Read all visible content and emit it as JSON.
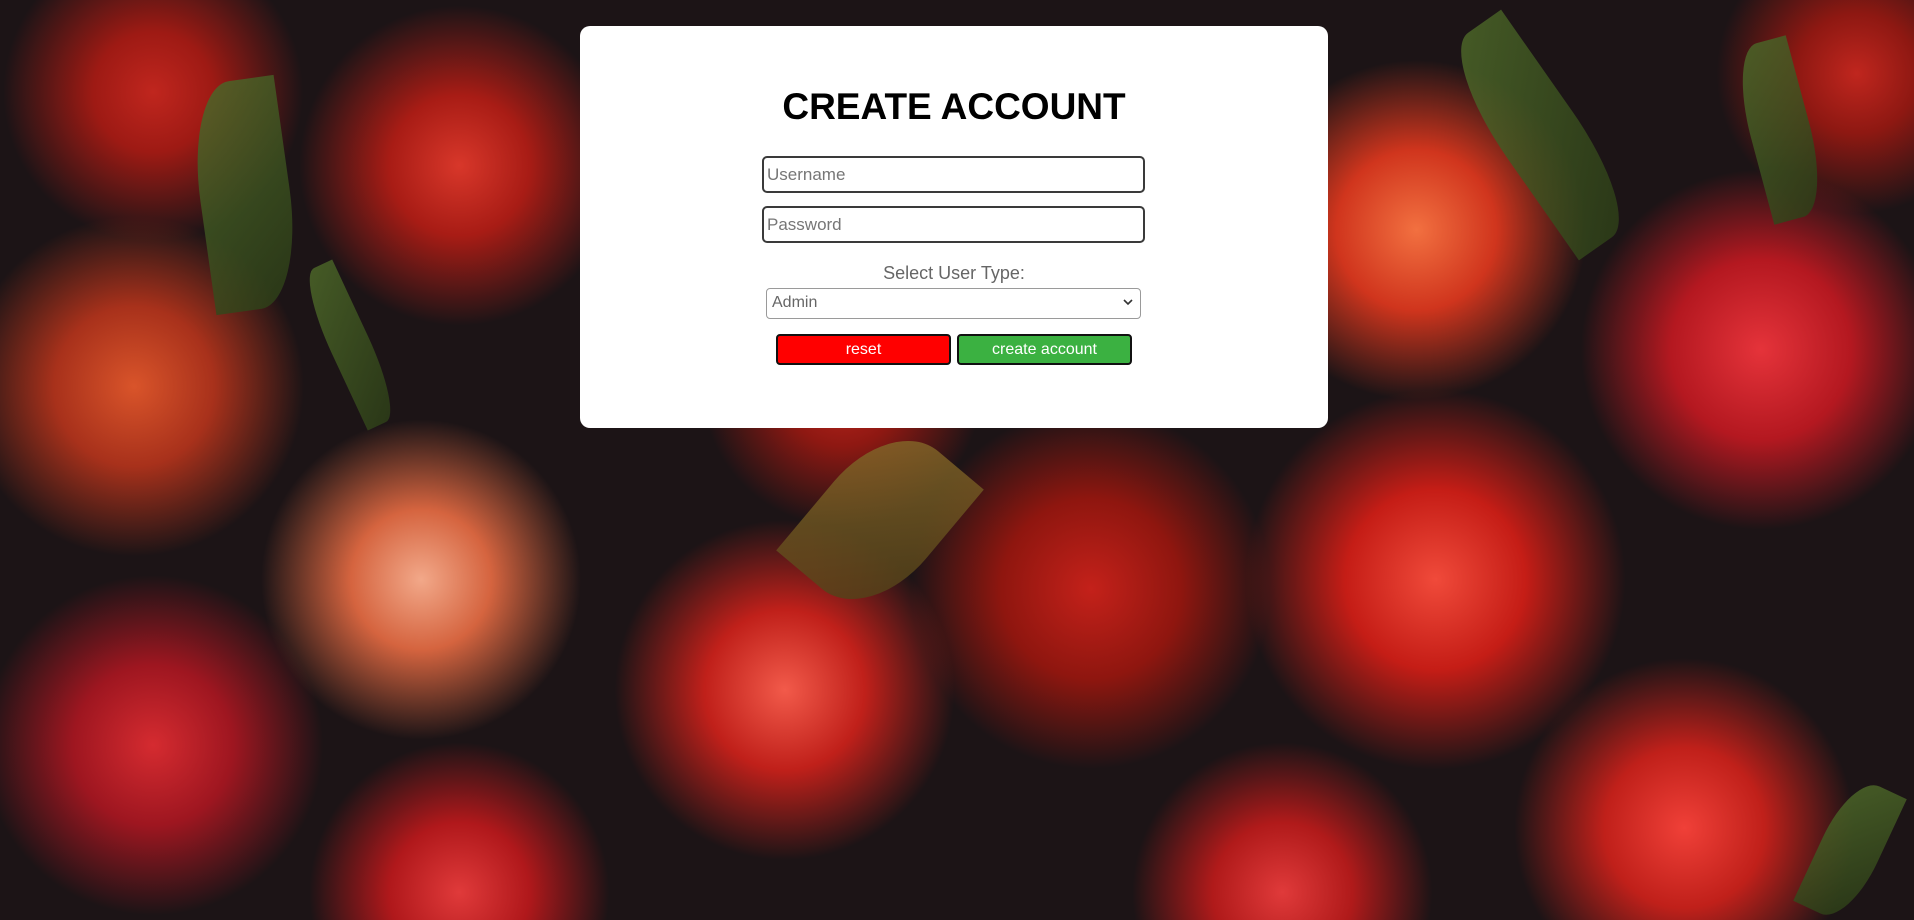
{
  "background": {
    "description_icon": "rambutan-photo-background"
  },
  "form": {
    "title": "CREATE ACCOUNT",
    "username_placeholder": "Username",
    "password_placeholder": "Password",
    "select_label": "Select User Type:",
    "user_type_selected": "Admin",
    "reset_label": "reset",
    "create_label": "create account"
  },
  "colors": {
    "reset_button": "#ff0000",
    "create_button": "#3bb141",
    "card": "#ffffff"
  }
}
